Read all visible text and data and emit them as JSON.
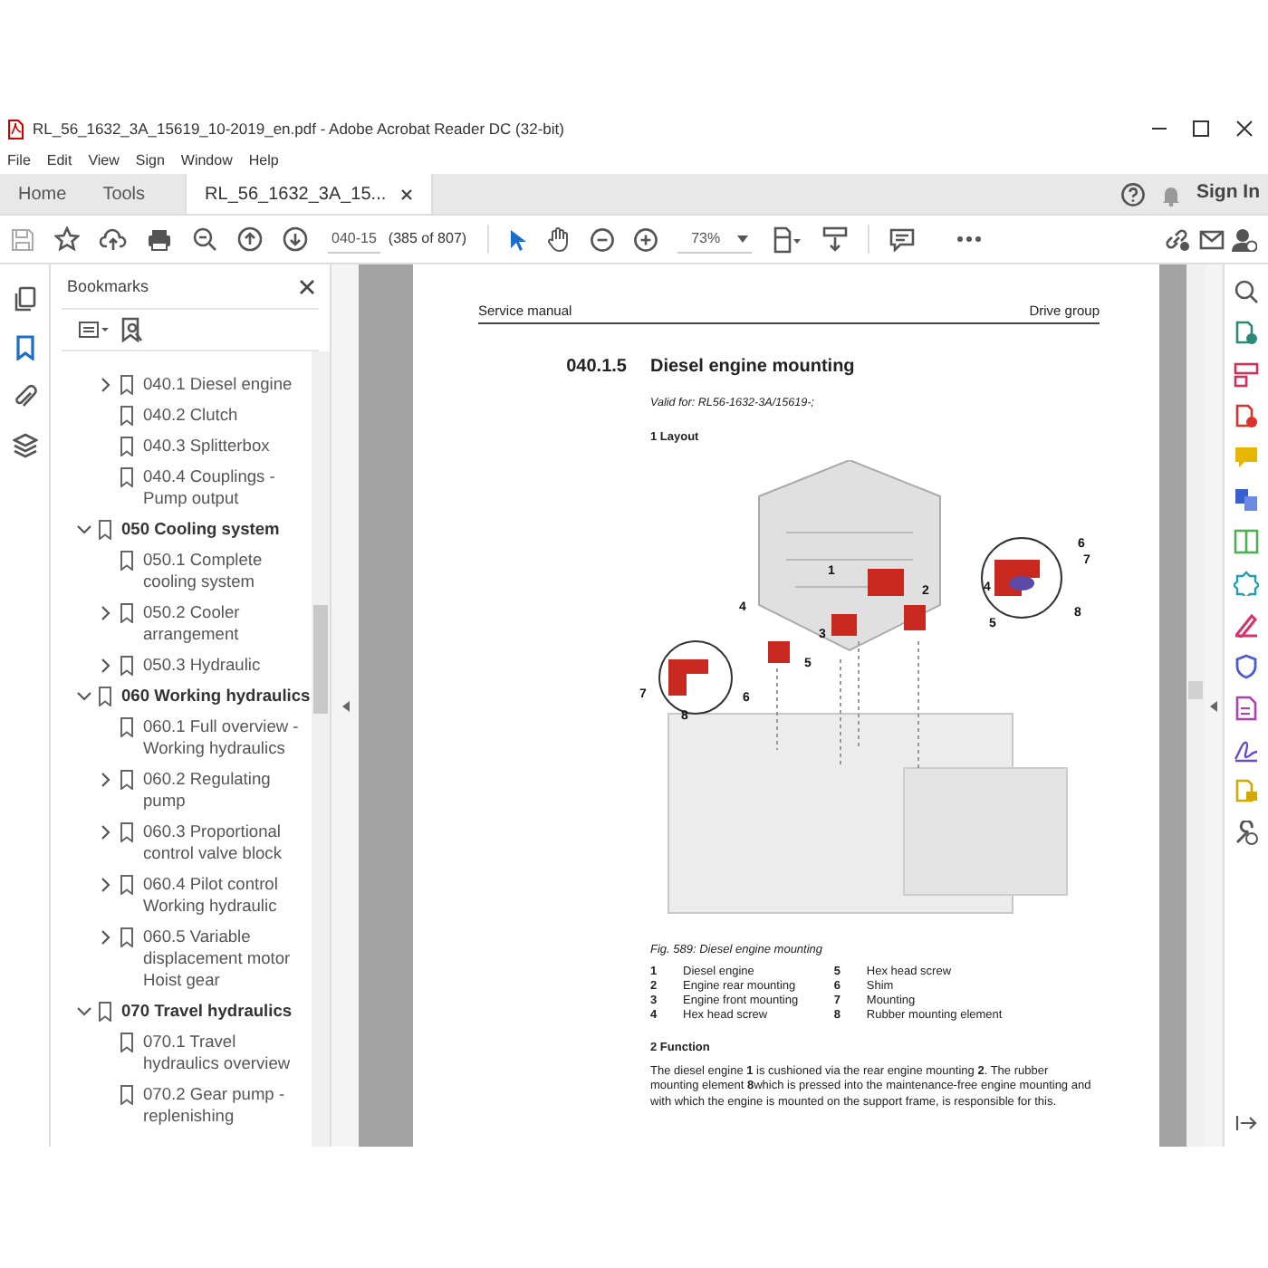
{
  "window": {
    "title": "RL_56_1632_3A_15619_10-2019_en.pdf - Adobe Acrobat Reader DC (32-bit)"
  },
  "menu": [
    "File",
    "Edit",
    "View",
    "Sign",
    "Window",
    "Help"
  ],
  "tabs": [
    {
      "label": "Home",
      "selected": false
    },
    {
      "label": "Tools",
      "selected": false
    },
    {
      "label": "RL_56_1632_3A_15...",
      "selected": true
    }
  ],
  "account": {
    "sign_in": "Sign In"
  },
  "toolbar": {
    "page": "040-15",
    "page_count": "(385 of 807)",
    "zoom": "73%"
  },
  "left_rail": [
    {
      "kind": "pages",
      "selected": false
    },
    {
      "kind": "bookmarks",
      "selected": true
    },
    {
      "kind": "attachments",
      "selected": false
    },
    {
      "kind": "layers",
      "selected": false
    }
  ],
  "bookmarks": {
    "title": "Bookmarks",
    "items": [
      {
        "children": [
          {
            "label": "040.1 Diesel engine",
            "expanded": false
          },
          {
            "label": "040.2 Clutch"
          },
          {
            "label": "040.3 Splitterbox"
          },
          {
            "label": "040.4 Couplings - Pump output"
          }
        ]
      },
      {
        "label": "050 Cooling system",
        "expanded": true,
        "children": [
          {
            "label": "050.1 Complete cooling system"
          },
          {
            "label": "050.2 Cooler arrangement",
            "expanded": false
          },
          {
            "label": "050.3 Hydraulic",
            "expanded": false
          }
        ]
      },
      {
        "label": "060 Working hydraulics",
        "expanded": true,
        "children": [
          {
            "label": "060.1 Full overview - Working hydraulics"
          },
          {
            "label": "060.2 Regulating pump",
            "expanded": false
          },
          {
            "label": "060.3 Proportional control valve block",
            "expanded": false
          },
          {
            "label": "060.4 Pilot control Working hydraulic",
            "expanded": false
          },
          {
            "label": "060.5 Variable displacement motor Hoist gear",
            "expanded": false
          }
        ]
      },
      {
        "label": "070 Travel hydraulics",
        "expanded": true,
        "children": [
          {
            "label": "070.1 Travel hydraulics overview"
          },
          {
            "label": "070.2 Gear pump - replenishing"
          }
        ]
      }
    ]
  },
  "document": {
    "header_left": "Service manual",
    "header_right": "Drive group",
    "section_number": "040.1.5",
    "section_title": "Diesel engine mounting",
    "valid_for": "Valid for: RL56-1632-3A/15619-;",
    "layout_heading": "1 Layout",
    "figure": {
      "callouts": [
        "1",
        "2",
        "3",
        "4",
        "5",
        "6",
        "7",
        "8",
        "6",
        "7",
        "4",
        "5",
        "8"
      ],
      "caption": "Fig. 589: Diesel engine mounting"
    },
    "legend": [
      {
        "number": "1",
        "text": "Diesel engine"
      },
      {
        "number": "2",
        "text": "Engine rear mounting"
      },
      {
        "number": "3",
        "text": "Engine front mounting"
      },
      {
        "number": "4",
        "text": "Hex head screw"
      },
      {
        "number": "5",
        "text": "Hex head screw"
      },
      {
        "number": "6",
        "text": "Shim"
      },
      {
        "number": "7",
        "text": "Mounting"
      },
      {
        "number": "8",
        "text": "Rubber mounting element"
      }
    ],
    "function_heading": "2 Function",
    "function_text": "The diesel engine **1** is cushioned via the rear engine mounting **2**. The rubber mounting element **8**which is pressed into the maintenance-free engine mounting and with which the engine is mounted on the support frame, is responsible for this."
  }
}
